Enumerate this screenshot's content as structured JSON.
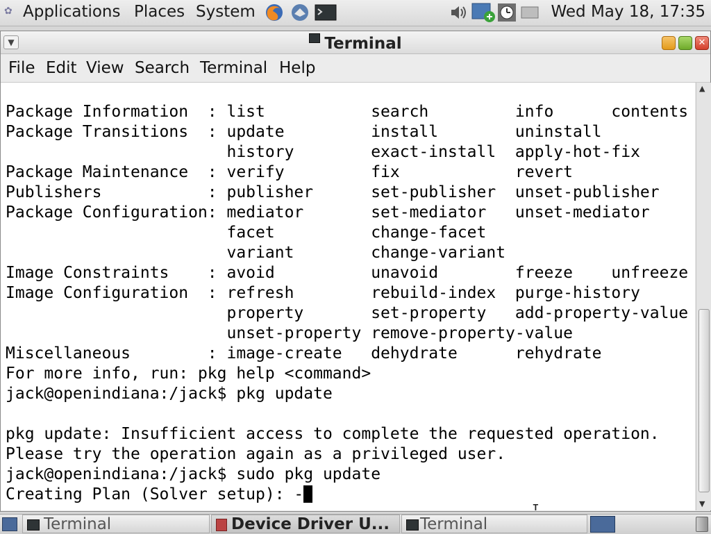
{
  "top_panel": {
    "menus": [
      "Applications",
      "Places",
      "System"
    ],
    "clock": "Wed May 18, 17:35"
  },
  "window": {
    "title": "Terminal",
    "menubar": [
      "File",
      "Edit",
      "View",
      "Search",
      "Terminal",
      "Help"
    ]
  },
  "terminal": {
    "lines": [
      "Package Information  : list           search         info      contents",
      "Package Transitions  : update         install        uninstall",
      "                       history        exact-install  apply-hot-fix",
      "Package Maintenance  : verify         fix            revert",
      "Publishers           : publisher      set-publisher  unset-publisher",
      "Package Configuration: mediator       set-mediator   unset-mediator",
      "                       facet          change-facet",
      "                       variant        change-variant",
      "Image Constraints    : avoid          unavoid        freeze    unfreeze",
      "Image Configuration  : refresh        rebuild-index  purge-history",
      "                       property       set-property   add-property-value",
      "                       unset-property remove-property-value",
      "Miscellaneous        : image-create   dehydrate      rehydrate",
      "For more info, run: pkg help <command>",
      "jack@openindiana:/jack$ pkg update",
      "",
      "pkg update: Insufficient access to complete the requested operation.",
      "Please try the operation again as a privileged user.",
      "jack@openindiana:/jack$ sudo pkg update"
    ],
    "current_line": "Creating Plan (Solver setup): -"
  },
  "taskbar": {
    "tasks": [
      "Terminal",
      "Device Driver U...",
      "Terminal"
    ]
  }
}
